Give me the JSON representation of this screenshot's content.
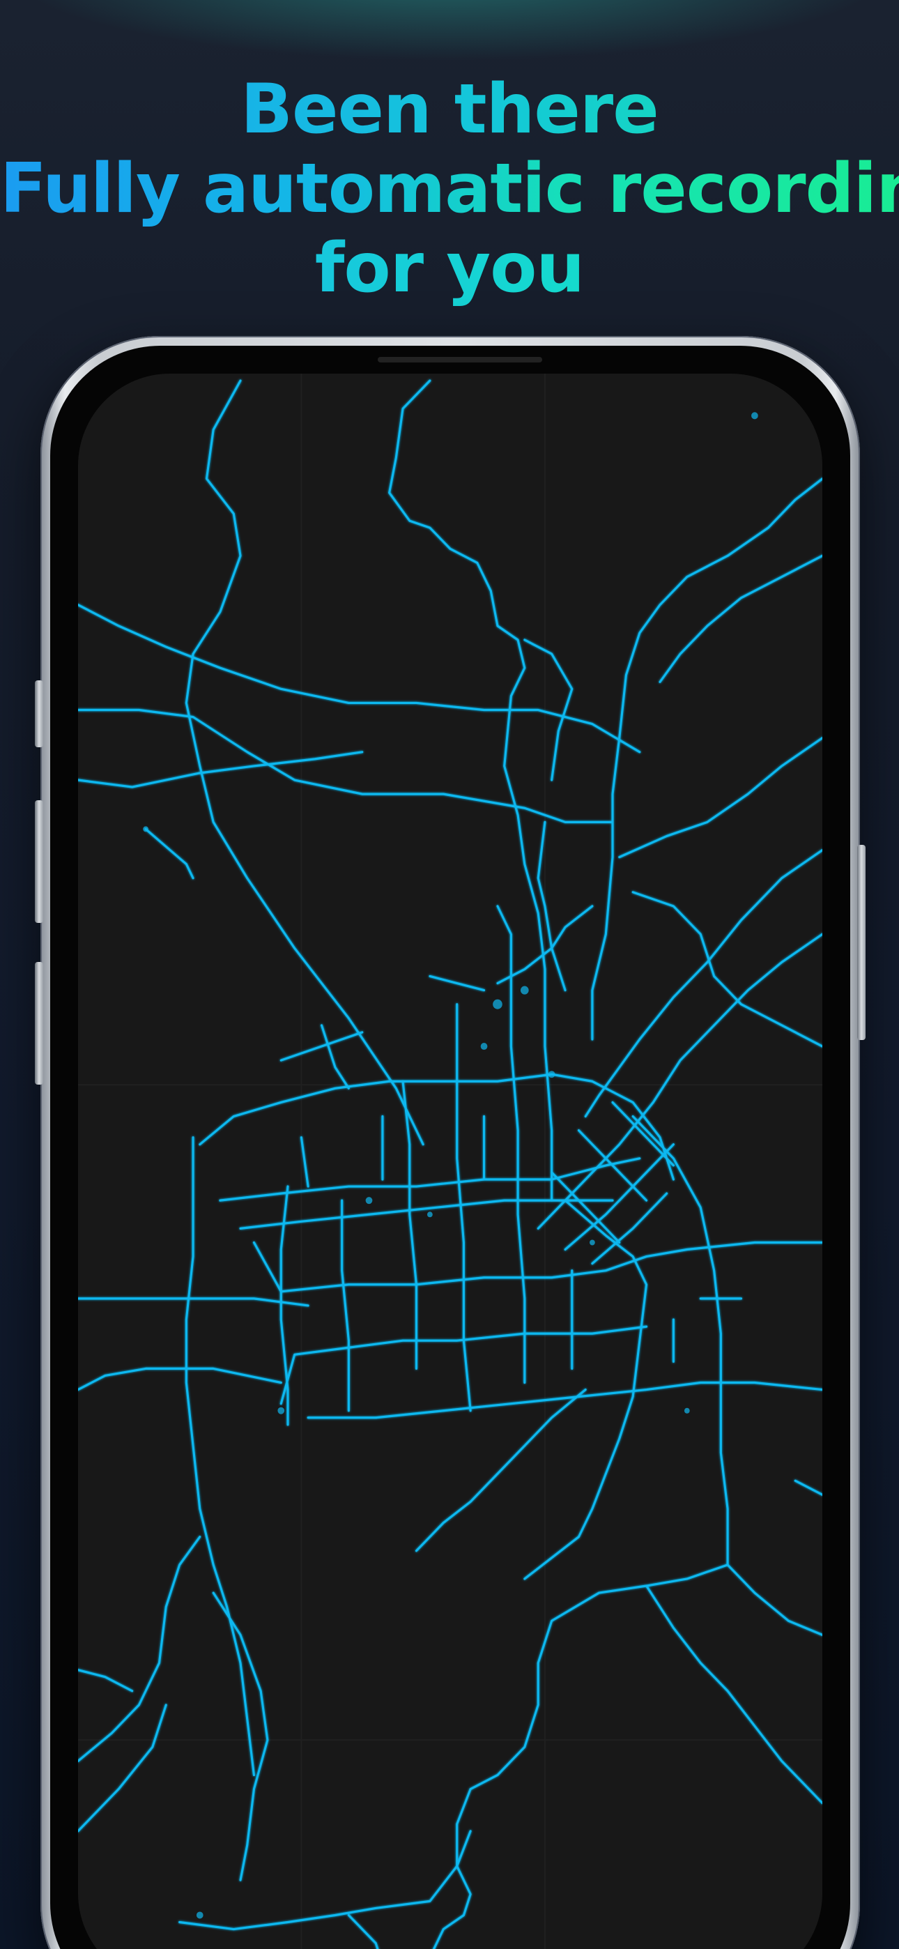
{
  "headline": {
    "line1": "Been there",
    "line2": "Fully automatic recording",
    "line3": "for you"
  },
  "colors": {
    "background": "#111726",
    "headline_gradient_start": "#1a9cf0",
    "headline_gradient_end": "#19ec94",
    "track_color": "#10b8f0",
    "map_background": "#181818",
    "phone_frame": "#dfe2e6"
  },
  "screen": {
    "content": "footprint-map"
  }
}
